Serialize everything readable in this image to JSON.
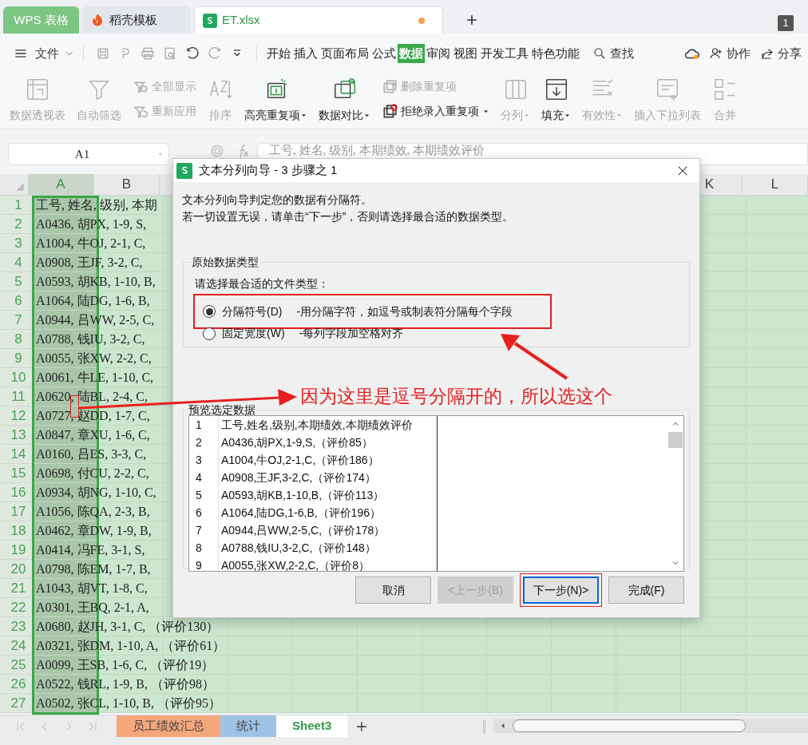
{
  "app_tabs": [
    {
      "label": "WPS 表格",
      "kind": "home",
      "selected": false
    },
    {
      "label": "稻壳模板",
      "kind": "template",
      "selected": false
    },
    {
      "label": "ET.xlsx",
      "kind": "document",
      "selected": true,
      "modified": true
    }
  ],
  "window_badge": "1",
  "menu": {
    "file": "文件",
    "tabs": [
      {
        "label": "开始",
        "selected": false
      },
      {
        "label": "插入",
        "selected": false
      },
      {
        "label": "页面布局",
        "selected": false
      },
      {
        "label": "公式",
        "selected": false
      },
      {
        "label": "数据",
        "selected": true
      },
      {
        "label": "审阅",
        "selected": false
      },
      {
        "label": "视图",
        "selected": false
      },
      {
        "label": "开发工具",
        "selected": false
      },
      {
        "label": "特色功能",
        "selected": false
      }
    ],
    "search": "查找",
    "collaborate": "协作",
    "share": "分享"
  },
  "ribbon": [
    {
      "label": "数据透视表",
      "kind": "large",
      "disabled": true,
      "dropdown": false
    },
    {
      "label": "自动筛选",
      "kind": "large",
      "disabled": true,
      "dropdown": false
    },
    {
      "label": "全部显示",
      "kind": "small",
      "disabled": true,
      "dropdown": false
    },
    {
      "label": "重新应用",
      "kind": "small",
      "disabled": true,
      "dropdown": false
    },
    {
      "label": "排序",
      "kind": "large",
      "disabled": true,
      "dropdown": false
    },
    {
      "label": "高亮重复项",
      "kind": "large",
      "disabled": false,
      "dropdown": true
    },
    {
      "label": "数据对比",
      "kind": "large",
      "disabled": false,
      "dropdown": true
    },
    {
      "label": "删除重复项",
      "kind": "small",
      "disabled": true,
      "dropdown": false
    },
    {
      "label": "拒绝录入重复项",
      "kind": "small",
      "disabled": false,
      "dropdown": true
    },
    {
      "label": "分列",
      "kind": "large",
      "disabled": true,
      "dropdown": true
    },
    {
      "label": "填充",
      "kind": "large",
      "disabled": false,
      "dropdown": true
    },
    {
      "label": "有效性",
      "kind": "large",
      "disabled": true,
      "dropdown": true
    },
    {
      "label": "插入下拉列表",
      "kind": "large",
      "disabled": true,
      "dropdown": false
    },
    {
      "label": "合并",
      "kind": "large",
      "disabled": true,
      "dropdown": false
    }
  ],
  "name_box": "A1",
  "formula": "工号, 姓名, 级别, 本期绩效, 本期绩效评价",
  "sheet": {
    "columns": [
      {
        "label": "A",
        "selected": true
      },
      {
        "label": "B",
        "selected": false
      },
      {
        "label": "K",
        "selected": false
      },
      {
        "label": "L",
        "selected": false
      }
    ],
    "rows": [
      {
        "number": "1",
        "text": "工号, 姓名, 级别, 本期"
      },
      {
        "number": "2",
        "text": "A0436, 胡PX, 1-9, S,"
      },
      {
        "number": "3",
        "text": "A1004, 牛OJ, 2-1, C,"
      },
      {
        "number": "4",
        "text": "A0908, 王JF, 3-2, C,"
      },
      {
        "number": "5",
        "text": "A0593, 胡KB, 1-10, B,"
      },
      {
        "number": "6",
        "text": "A1064, 陆DG, 1-6, B,"
      },
      {
        "number": "7",
        "text": "A0944, 吕WW, 2-5, C,"
      },
      {
        "number": "8",
        "text": "A0788, 钱IU, 3-2, C,"
      },
      {
        "number": "9",
        "text": "A0055, 张XW, 2-2, C,"
      },
      {
        "number": "10",
        "text": "A0061, 牛LE, 1-10, C,"
      },
      {
        "number": "11",
        "text": "A0620, 陆BL, 2-4, C,"
      },
      {
        "number": "12",
        "text": "A0727, 赵DD, 1-7, C,"
      },
      {
        "number": "13",
        "text": "A0847, 章XU, 1-6, C,"
      },
      {
        "number": "14",
        "text": "A0160, 吕ES, 3-3, C,"
      },
      {
        "number": "15",
        "text": "A0698, 付CU, 2-2, C,"
      },
      {
        "number": "16",
        "text": "A0934, 胡NG, 1-10, C,"
      },
      {
        "number": "17",
        "text": "A1056, 陈QA, 2-3, B,"
      },
      {
        "number": "18",
        "text": "A0462, 章DW, 1-9, B,"
      },
      {
        "number": "19",
        "text": "A0414, 冯FE, 3-1, S,"
      },
      {
        "number": "20",
        "text": "A0798, 陈EM, 1-7, B,"
      },
      {
        "number": "21",
        "text": "A1043, 胡VT, 1-8, C,"
      },
      {
        "number": "22",
        "text": "A0301, 王BQ, 2-1, A,"
      },
      {
        "number": "23",
        "text": "A0680, 赵JH, 3-1, C, （评价130）"
      },
      {
        "number": "24",
        "text": "A0321, 张DM, 1-10, A, （评价61）"
      },
      {
        "number": "25",
        "text": "A0099, 王SB, 1-6, C, （评价19）"
      },
      {
        "number": "26",
        "text": "A0522, 钱RL, 1-9, B, （评价98）"
      },
      {
        "number": "27",
        "text": "A0502, 张CL, 1-10, B, （评价95）"
      }
    ]
  },
  "dialog": {
    "title": "文本分列向导 - 3 步骤之 1",
    "intro": [
      "文本分列向导判定您的数据有分隔符。",
      "若一切设置无误，请单击“下一步”，否则请选择最合适的数据类型。"
    ],
    "type_group": {
      "legend": "原始数据类型",
      "prompt": "请选择最合适的文件类型：",
      "options": [
        {
          "label": "分隔符号(D)",
          "description": "-用分隔字符，如逗号或制表符分隔每个字段",
          "selected": true,
          "highlighted": true
        },
        {
          "label": "固定宽度(W)",
          "description": "-每列字段加空格对齐",
          "selected": false,
          "highlighted": false
        }
      ]
    },
    "preview": {
      "legend": "预览选定数据",
      "lines": [
        {
          "number": "1",
          "text": "工号,姓名,级别,本期绩效,本期绩效评价"
        },
        {
          "number": "2",
          "text": "A0436,胡PX,1-9,S,（评价85）"
        },
        {
          "number": "3",
          "text": "A1004,牛OJ,2-1,C,（评价186）"
        },
        {
          "number": "4",
          "text": "A0908,王JF,3-2,C,（评价174）"
        },
        {
          "number": "5",
          "text": "A0593,胡KB,1-10,B,（评价113）"
        },
        {
          "number": "6",
          "text": "A1064,陆DG,1-6,B,（评价196）"
        },
        {
          "number": "7",
          "text": "A0944,吕WW,2-5,C,（评价178）"
        },
        {
          "number": "8",
          "text": "A0788,钱IU,3-2,C,（评价148）"
        },
        {
          "number": "9",
          "text": "A0055,张XW,2-2,C,（评价8）"
        }
      ]
    },
    "buttons": [
      {
        "label": "取消",
        "disabled": false,
        "focused": false,
        "highlighted": false
      },
      {
        "label": "<上一步(B)",
        "disabled": true,
        "focused": false,
        "highlighted": false
      },
      {
        "label": "下一步(N)>",
        "disabled": false,
        "focused": true,
        "highlighted": true
      },
      {
        "label": "完成(F)",
        "disabled": false,
        "focused": false,
        "highlighted": false
      }
    ]
  },
  "annotation": {
    "text": "因为这里是逗号分隔开的，所以选这个"
  },
  "sheet_tabs": [
    {
      "label": "员工绩效汇总",
      "selected": false,
      "color": "#f4a77a"
    },
    {
      "label": "统计",
      "selected": false,
      "color": "#9fc3e7"
    },
    {
      "label": "Sheet3",
      "selected": true,
      "color": "#ffffff"
    }
  ]
}
